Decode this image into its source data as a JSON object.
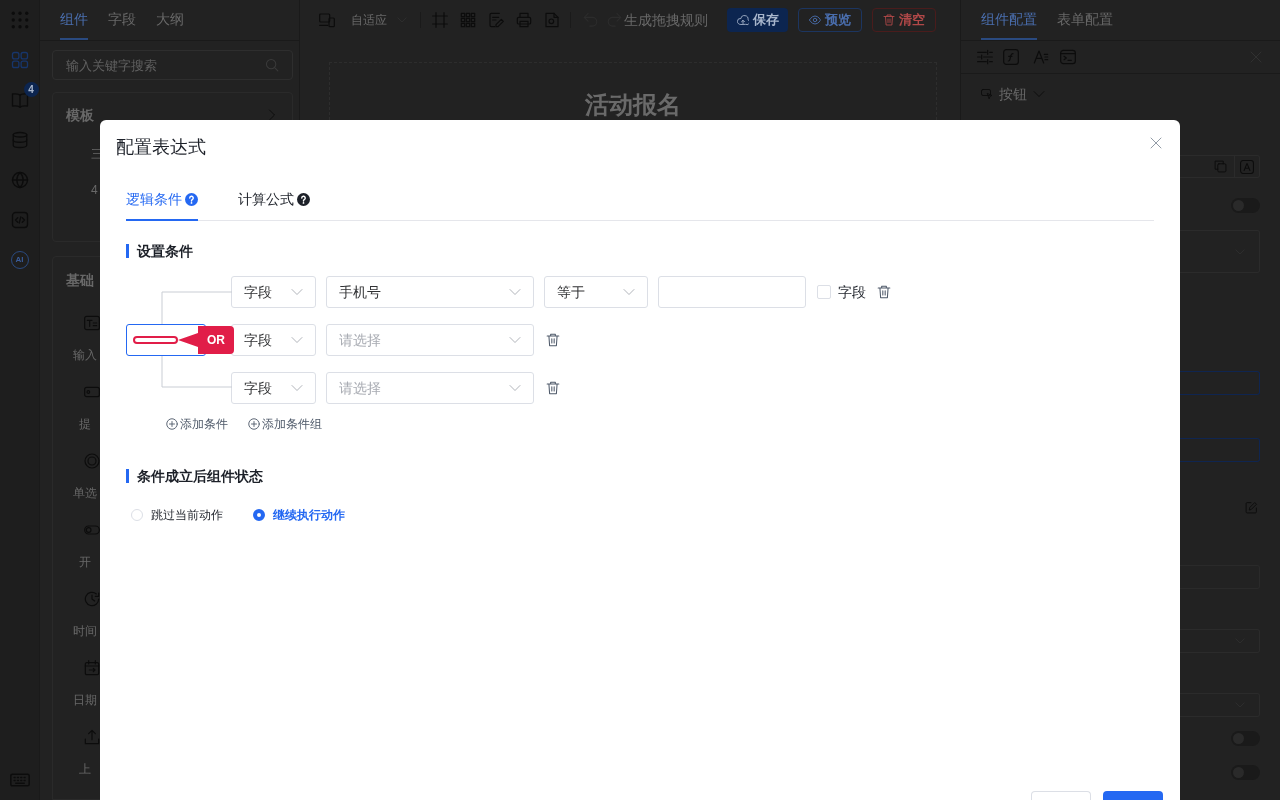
{
  "app": {
    "rail": [
      {
        "selected": true
      },
      {
        "selected": false,
        "badge": "4"
      },
      {
        "selected": false
      },
      {
        "selected": false
      },
      {
        "selected": false
      },
      {
        "selected": false,
        "label": "AI"
      }
    ],
    "left_panel": {
      "tabs": [
        {
          "label": "组件",
          "selected": true
        },
        {
          "label": "字段",
          "selected": false
        },
        {
          "label": "大纲",
          "selected": false
        }
      ],
      "search": {
        "placeholder": "输入关键字搜索"
      },
      "template_section": {
        "title": "模板",
        "items": [
          "三",
          "4"
        ]
      },
      "basic_section": {
        "title": "基础",
        "items": [
          {
            "kind": "input",
            "label": "输入"
          },
          {
            "kind": "submit",
            "label": "提"
          },
          {
            "kind": "radio",
            "label": "单选"
          },
          {
            "kind": "switch",
            "label": "开"
          },
          {
            "kind": "time",
            "label": "时间"
          },
          {
            "kind": "date",
            "label": "日期"
          },
          {
            "kind": "upload",
            "label": "上"
          }
        ]
      }
    },
    "toolbar": {
      "device_mode": "自适应",
      "rule_button": "生成拖拽规则",
      "buttons": [
        {
          "kind": "save",
          "label": "保存"
        },
        {
          "kind": "preview",
          "label": "预览"
        },
        {
          "kind": "clear",
          "label": "清空"
        }
      ]
    },
    "canvas": {
      "title": "活动报名"
    },
    "right_panel": {
      "tabs": [
        {
          "label": "组件配置",
          "selected": true
        },
        {
          "label": "表单配置",
          "selected": false
        }
      ],
      "component_type": "按钮",
      "fields": [
        {
          "kind": "actions"
        },
        {
          "kind": "toggle",
          "on": false
        },
        {
          "kind": "select"
        },
        {
          "kind": "input",
          "focused": true
        },
        {
          "kind": "input",
          "focused": true
        },
        {
          "kind": "edit"
        },
        {
          "kind": "input",
          "focused": false
        },
        {
          "kind": "select"
        },
        {
          "kind": "select"
        },
        {
          "kind": "toggle",
          "on": false
        },
        {
          "kind": "toggle",
          "on": false
        }
      ]
    }
  },
  "dialog": {
    "title": "配置表达式",
    "tabs": [
      {
        "label": "逻辑条件",
        "selected": true
      },
      {
        "label": "计算公式",
        "selected": false
      }
    ],
    "condition_section": {
      "title": "设置条件",
      "relation_box": {
        "focused": true
      },
      "rows": [
        {
          "kind": "comparison",
          "source": "字段",
          "field": "手机号",
          "operator": "等于",
          "value_source": {
            "label": "字段",
            "checked": false
          }
        },
        {
          "kind": "pending",
          "source": "字段",
          "placeholder": "请选择"
        },
        {
          "kind": "pending",
          "source": "字段",
          "placeholder": "请选择"
        }
      ],
      "actions": [
        "添加条件",
        "添加条件组"
      ]
    },
    "annotation": {
      "label": "OR"
    },
    "state_section": {
      "title": "条件成立后组件状态",
      "options": [
        {
          "label": "跳过当前动作",
          "selected": false
        },
        {
          "label": "继续执行动作",
          "selected": true
        }
      ]
    },
    "footer_buttons": [
      {
        "kind": "secondary"
      },
      {
        "kind": "primary"
      }
    ]
  }
}
